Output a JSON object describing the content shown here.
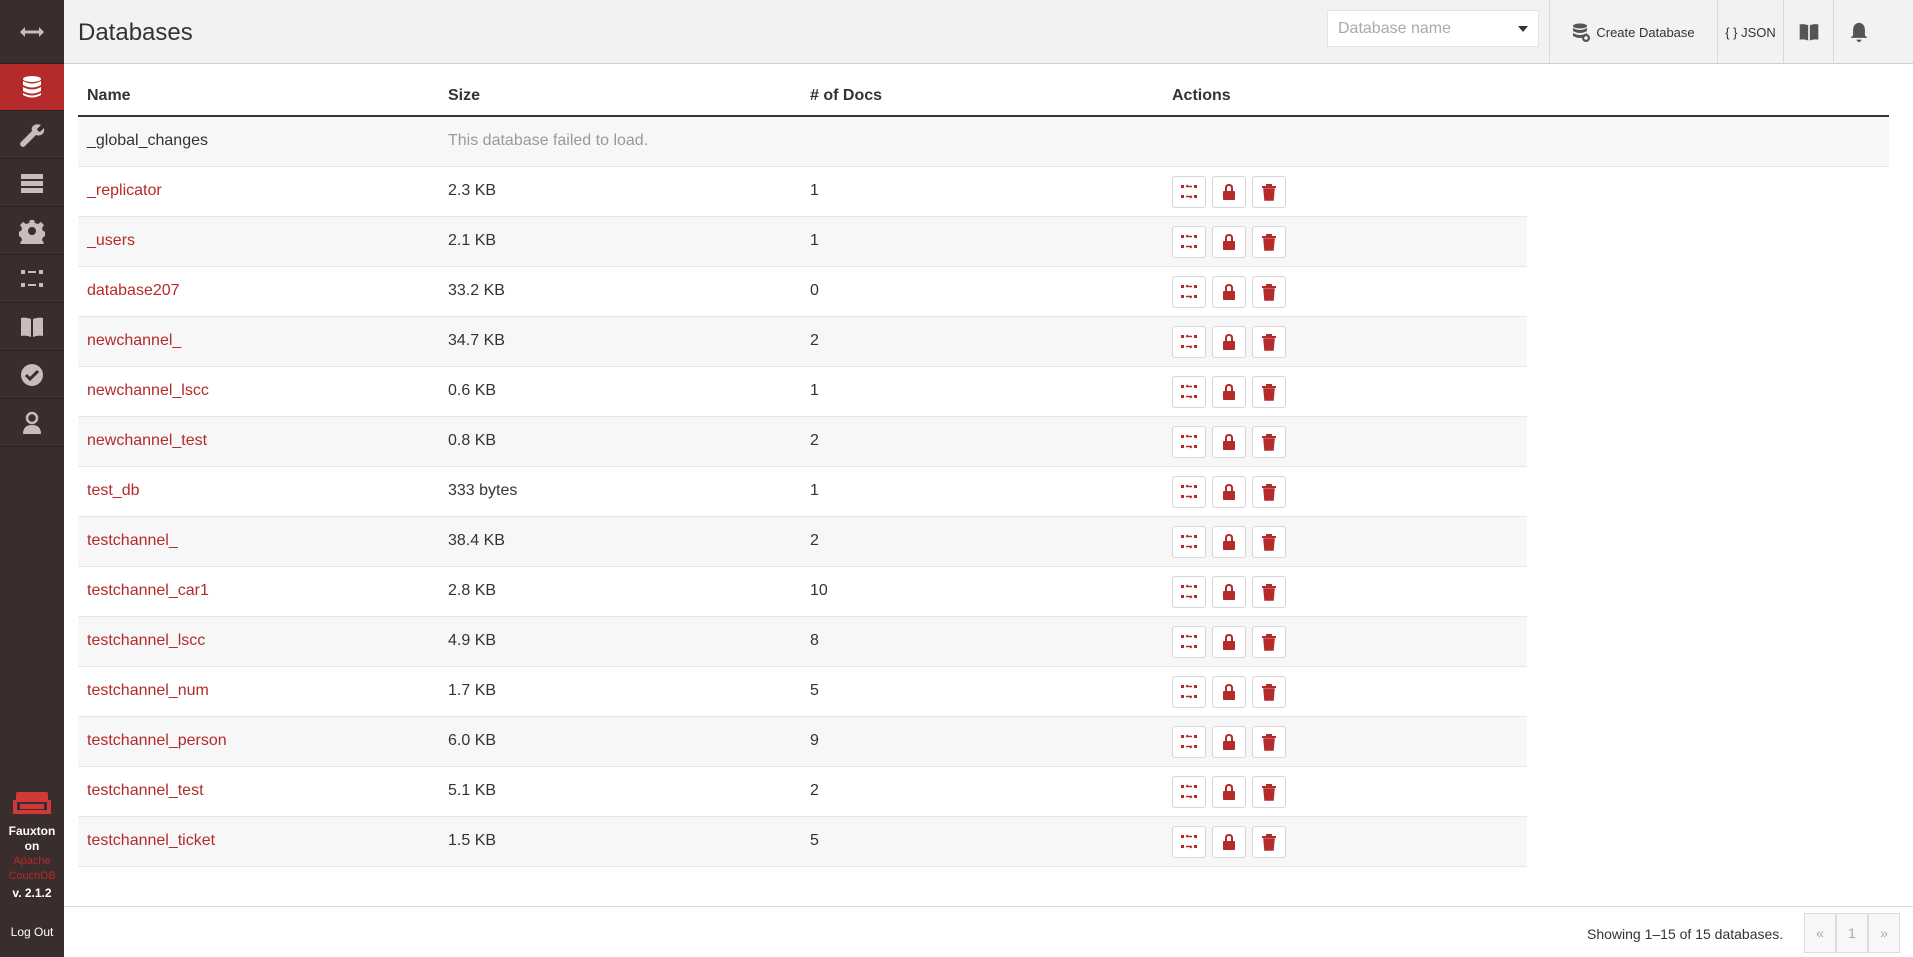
{
  "header": {
    "title": "Databases",
    "search_placeholder": "Database name",
    "create_label": "Create Database",
    "json_label": "{ } JSON"
  },
  "sidebar": {
    "items": [
      "toggle-icon",
      "databases-icon",
      "wrench-icon",
      "server-icon",
      "gear-icon",
      "replication-icon",
      "book-icon",
      "check-icon",
      "user-icon"
    ],
    "brand_line1": "Fauxton on",
    "brand_line2": "Apache",
    "brand_line3": "CouchDB",
    "version": "v. 2.1.2",
    "logout": "Log Out"
  },
  "table": {
    "headers": {
      "name": "Name",
      "size": "Size",
      "docs": "# of Docs",
      "actions": "Actions"
    },
    "failed_row": {
      "name": "_global_changes",
      "message": "This database failed to load."
    },
    "rows": [
      {
        "name": "_replicator",
        "size": "2.3 KB",
        "docs": "1"
      },
      {
        "name": "_users",
        "size": "2.1 KB",
        "docs": "1"
      },
      {
        "name": "database207",
        "size": "33.2 KB",
        "docs": "0"
      },
      {
        "name": "newchannel_",
        "size": "34.7 KB",
        "docs": "2"
      },
      {
        "name": "newchannel_lscc",
        "size": "0.6 KB",
        "docs": "1"
      },
      {
        "name": "newchannel_test",
        "size": "0.8 KB",
        "docs": "2"
      },
      {
        "name": "test_db",
        "size": "333 bytes",
        "docs": "1"
      },
      {
        "name": "testchannel_",
        "size": "38.4 KB",
        "docs": "2"
      },
      {
        "name": "testchannel_car1",
        "size": "2.8 KB",
        "docs": "10"
      },
      {
        "name": "testchannel_lscc",
        "size": "4.9 KB",
        "docs": "8"
      },
      {
        "name": "testchannel_num",
        "size": "1.7 KB",
        "docs": "5"
      },
      {
        "name": "testchannel_person",
        "size": "6.0 KB",
        "docs": "9"
      },
      {
        "name": "testchannel_test",
        "size": "5.1 KB",
        "docs": "2"
      },
      {
        "name": "testchannel_ticket",
        "size": "1.5 KB",
        "docs": "5"
      }
    ]
  },
  "footer": {
    "count_text": "Showing 1–15 of 15 databases.",
    "prev": "«",
    "page": "1",
    "next": "»"
  },
  "colors": {
    "accent": "#b52a2a",
    "sidebar": "#3a2d2d"
  }
}
